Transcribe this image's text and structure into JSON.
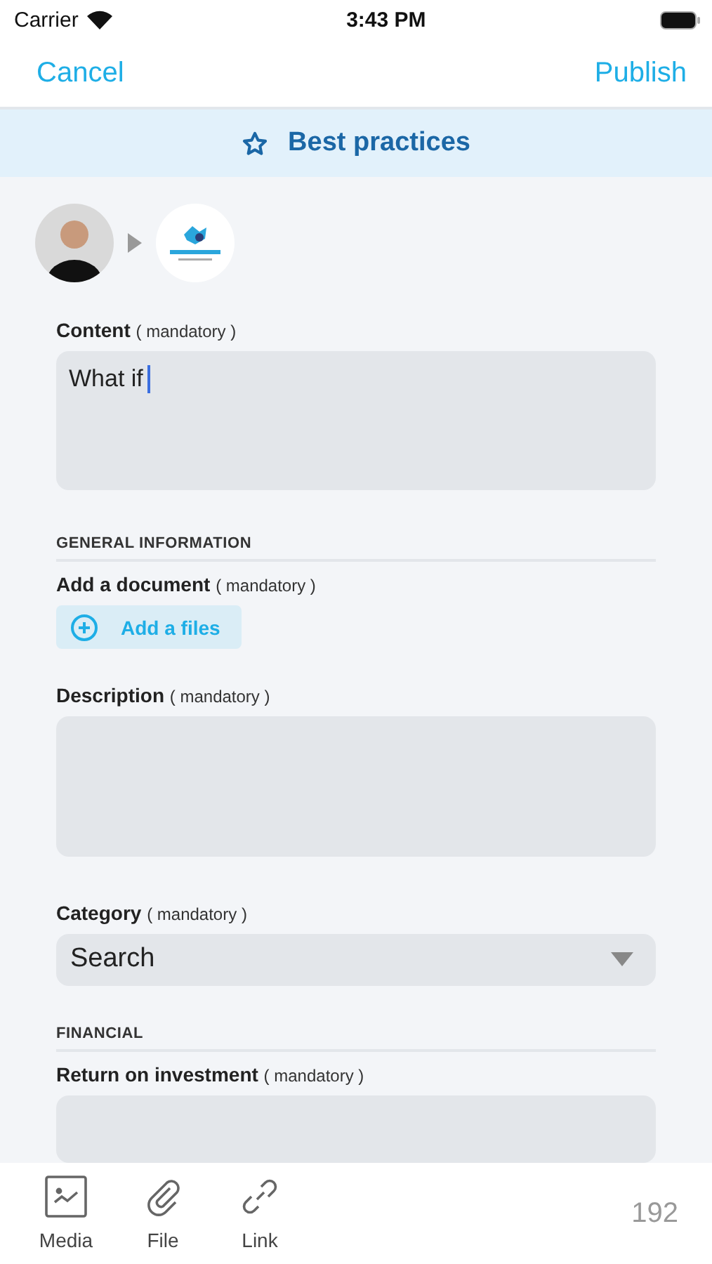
{
  "status_bar": {
    "carrier": "Carrier",
    "time": "3:43 PM"
  },
  "nav": {
    "cancel": "Cancel",
    "publish": "Publish"
  },
  "banner": {
    "title": "Best practices"
  },
  "form": [
    {
      "kind": "textarea",
      "label": "Content",
      "note": "( mandatory )",
      "value": "What if",
      "focused": true
    },
    {
      "kind": "section",
      "title": "GENERAL INFORMATION"
    },
    {
      "kind": "upload",
      "label": "Add a document",
      "note": "( mandatory )",
      "button": "Add a files"
    },
    {
      "kind": "textarea",
      "label": "Description",
      "note": "( mandatory )",
      "focused": false
    },
    {
      "kind": "select",
      "label": "Category",
      "note": "( mandatory )",
      "value": "Search"
    },
    {
      "kind": "section",
      "title": "FINANCIAL"
    },
    {
      "kind": "input",
      "label": "Return on investment",
      "note": "( mandatory )"
    }
  ],
  "toolbar": {
    "items": [
      {
        "kind": "media",
        "label": "Media"
      },
      {
        "kind": "file",
        "label": "File"
      },
      {
        "kind": "link",
        "label": "Link"
      }
    ],
    "count": "192"
  }
}
